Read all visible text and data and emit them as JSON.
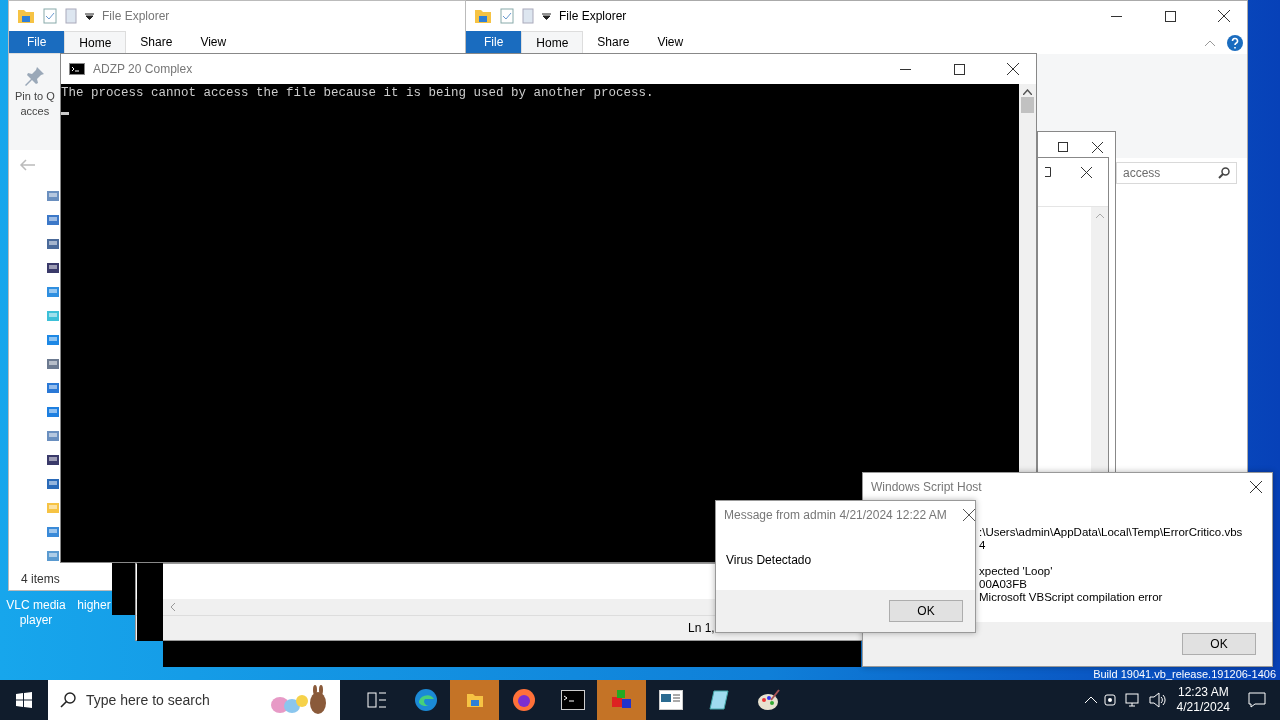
{
  "desktop": {
    "icons": [
      {
        "label": "VLC media player"
      },
      {
        "label": "higher"
      }
    ],
    "build_text": "Build 19041.vb_release.191206-1406"
  },
  "explorer_left": {
    "title": "File Explorer",
    "tabs": [
      {
        "label": "File",
        "kind": "file",
        "selected": false
      },
      {
        "label": "Home",
        "kind": "tab",
        "selected": true
      },
      {
        "label": "Share",
        "kind": "tab",
        "selected": false
      },
      {
        "label": "View",
        "kind": "tab",
        "selected": false
      }
    ],
    "ribbon_button": [
      "Pin to Q",
      "acces"
    ],
    "status": "4 items"
  },
  "explorer_right": {
    "title": "File Explorer",
    "tabs": [
      {
        "label": "File",
        "kind": "file",
        "selected": false
      },
      {
        "label": "Home",
        "kind": "tab",
        "selected": true
      },
      {
        "label": "Share",
        "kind": "tab",
        "selected": false
      },
      {
        "label": "View",
        "kind": "tab",
        "selected": false
      }
    ],
    "search": {
      "placeholder": "access"
    }
  },
  "console": {
    "title": "ADZP 20 Complex",
    "lines": [
      "The process cannot access the file because it is being used by another process."
    ]
  },
  "editor_behind": {
    "status": "Ln 1,"
  },
  "script_host": {
    "title": "Windows Script Host",
    "paragraphs": [
      [
        ":\\Users\\admin\\AppData\\Local\\Temp\\ErrorCritico.vbs",
        "4"
      ],
      [
        "xpected 'Loop'",
        "00A03FB",
        "Microsoft VBScript compilation error"
      ]
    ],
    "button": "OK"
  },
  "message": {
    "title": "Message from admin 4/21/2024 12:22 AM",
    "text": "Virus Detectado",
    "button": "OK"
  },
  "taskbar": {
    "search_placeholder": "Type here to search",
    "apps": [
      {
        "kind": "task-view",
        "active": false
      },
      {
        "kind": "edge",
        "active": false
      },
      {
        "kind": "explorer",
        "active": true
      },
      {
        "kind": "firefox",
        "active": false
      },
      {
        "kind": "terminal",
        "active": false
      },
      {
        "kind": "cube",
        "active": true
      },
      {
        "kind": "viewer",
        "active": false
      },
      {
        "kind": "notepad",
        "active": false
      },
      {
        "kind": "paint",
        "active": false
      }
    ],
    "time": "12:23 AM",
    "date": "4/21/2024"
  }
}
